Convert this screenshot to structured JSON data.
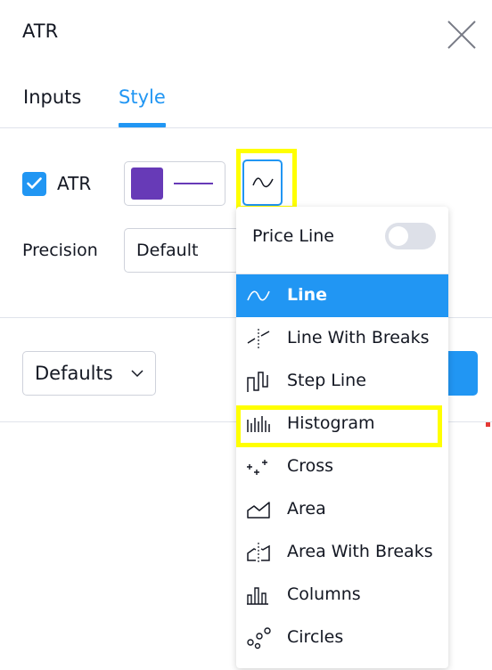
{
  "dialog": {
    "title": "ATR",
    "tabs": [
      {
        "label": "Inputs",
        "active": false
      },
      {
        "label": "Style",
        "active": true
      }
    ],
    "plot": {
      "checkbox_checked": true,
      "label": "ATR",
      "color": "#673ab7"
    },
    "precision": {
      "label": "Precision",
      "value": "Default"
    },
    "footer": {
      "defaults_label": "Defaults"
    },
    "accent_color": "#2196f3",
    "highlight_color": "#ffff00"
  },
  "menu": {
    "price_line_label": "Price Line",
    "price_line_on": false,
    "items": [
      {
        "label": "Line",
        "icon": "line-icon",
        "selected": true
      },
      {
        "label": "Line With Breaks",
        "icon": "line-with-breaks-icon",
        "selected": false
      },
      {
        "label": "Step Line",
        "icon": "step-line-icon",
        "selected": false
      },
      {
        "label": "Histogram",
        "icon": "histogram-icon",
        "selected": false
      },
      {
        "label": "Cross",
        "icon": "cross-icon",
        "selected": false
      },
      {
        "label": "Area",
        "icon": "area-icon",
        "selected": false
      },
      {
        "label": "Area With Breaks",
        "icon": "area-with-breaks-icon",
        "selected": false
      },
      {
        "label": "Columns",
        "icon": "columns-icon",
        "selected": false
      },
      {
        "label": "Circles",
        "icon": "circles-icon",
        "selected": false
      }
    ]
  }
}
